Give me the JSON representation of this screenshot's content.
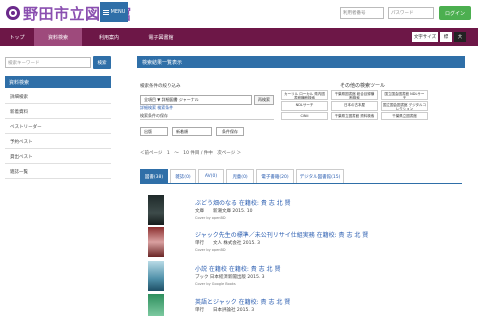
{
  "header": {
    "logo": "野田市立図書館",
    "menu_label": "MENU",
    "login_id_placeholder": "利用者番号",
    "login_pw_placeholder": "パスワード",
    "login_button": "ログイン"
  },
  "nav": {
    "items": [
      "トップ",
      "資料検索",
      "利用案内",
      "電子図書館"
    ],
    "active_index": 1,
    "size_label": "文字サイズ",
    "size_std": "標",
    "size_big": "大"
  },
  "sidebar": {
    "search_placeholder": "検索キーワード",
    "search_button": "検索",
    "header": "資料検索",
    "items": [
      "詳細検索",
      "新着資料",
      "ベストリーダー",
      "予約ベスト",
      "貸出ベスト",
      "雑誌一覧"
    ]
  },
  "main": {
    "title": "検索結果一覧表示",
    "conditions_label": "検索条件の絞り込み",
    "simple_select": "全項目 ▼ 詳細図書 ジャーナル",
    "change_button": "再検索",
    "detail_link": "詳細検索 検索条件",
    "history_label": "検索条件の保存",
    "sort_a": "出版",
    "sort_b": "新着順",
    "save_condition": "条件保存",
    "other_tools_title": "その他の検索ツール",
    "other_tools": [
      "カーリル ローカル 県内図書館横断検索",
      "千葉県図書館 総合目録横断検索",
      "国立国会図書館 NDLサーチ",
      "NDLサーチ",
      "日本の古本屋",
      "国立国会図書館 デジタルコレクション",
      "CiNii",
      "千葉県立図書館 資料検索",
      "千葉県立図書館"
    ],
    "pager": "＜前ページ　1　～　10 件目 / 件中　次ページ ＞",
    "tabs": [
      "図書(38)",
      "雑誌(0)",
      "AV(0)",
      "児童(0)",
      "電子書籍(20)",
      "デジタル図書館(15)"
    ],
    "active_tab": 0
  },
  "results": [
    {
      "title": "ぶどう畑のなる 在籍校: 貴 志 北 賢",
      "meta": "文庫　　新潮文庫 2015. 10",
      "cover": "Cover by openBD"
    },
    {
      "title": "ジャック先生の標準／未公刊リサイ仕組実務 在籍校: 貴 志 北 賢",
      "meta": "単行　　文人 株式会社 2015. 3",
      "cover": "Cover by openBD"
    },
    {
      "title": "小説 在籍校 在籍校: 貴 志 北 賢",
      "meta": "ブック 日本経済新聞出版 2015. 3",
      "cover": "Cover by Google Books"
    },
    {
      "title": "英語とジャック 在籍校: 貴 志 北 賢",
      "meta": "単行　　日本評論社 2015. 3",
      "cover": "Cover by openBD"
    }
  ]
}
